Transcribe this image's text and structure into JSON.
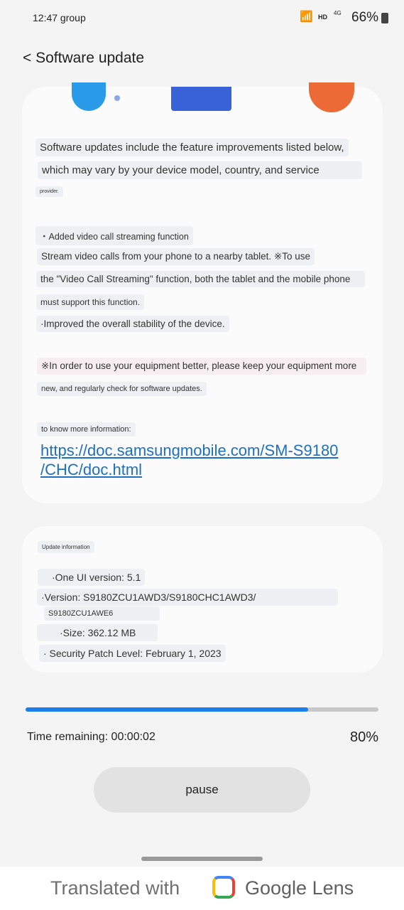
{
  "status_bar": {
    "time": "12:47 group",
    "network": "HD",
    "signal": "4G",
    "battery": "66%"
  },
  "header": {
    "back": "<",
    "title": "Software update"
  },
  "notes": {
    "intro": [
      "Software updates include the feature improvements listed below,",
      "which may vary by your device model, country, and service",
      "provider."
    ],
    "items": [
      "・Added video call streaming function",
      "Stream video calls from your phone to a nearby tablet. ※To use",
      "the \"Video Call Streaming\" function, both the tablet and the mobile phone",
      "must support this function.",
      "·Improved the overall stability of the device."
    ],
    "advice": [
      "※In order to use your equipment better, please keep your equipment more",
      "new, and regularly check for software updates."
    ],
    "more_label": "to know more information:",
    "link": [
      "https://doc.samsungmobile.com/SM-S9180",
      "/CHC/doc.html"
    ]
  },
  "update_info": {
    "title": "Update information",
    "one_ui": "·One UI version: 5.1",
    "version": "·Version: S9180ZCU1AWD3/S9180CHC1AWD3/",
    "version2": "S9180ZCU1AWE6",
    "size": "·Size: 362.12 MB",
    "patch": "· Security Patch Level: February 1, 2023"
  },
  "progress": {
    "percent": 80,
    "percent_label": "80%",
    "time_remaining": "Time remaining: 00:00:02",
    "color": "#1a7fe6"
  },
  "pause_label": "pause",
  "footer": {
    "translated": "Translated with",
    "brand": "Google Lens"
  }
}
